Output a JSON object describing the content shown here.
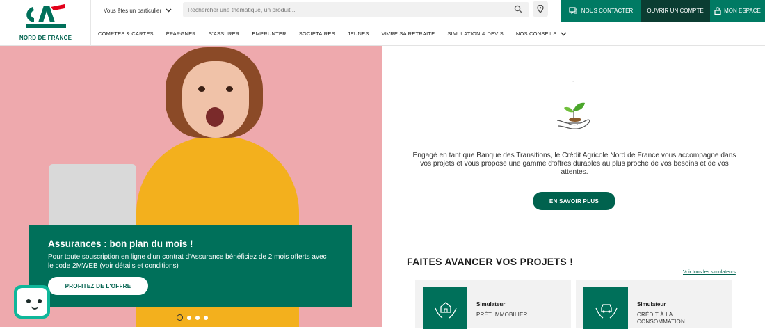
{
  "brand": {
    "logo_text": "NORD DE FRANCE",
    "primary_color": "#00705a",
    "dark_color": "#0b3d32",
    "accent_red": "#e2001a"
  },
  "header": {
    "profile_label": "Vous êtes un particulier",
    "search_placeholder": "Rechercher une thématique, un produit...",
    "contact_label": "NOUS CONTACTER",
    "open_account_label": "OUVRIR UN COMPTE",
    "my_space_label": "MON ESPACE"
  },
  "nav": {
    "items": [
      "COMPTES & CARTES",
      "ÉPARGNER",
      "S'ASSURER",
      "EMPRUNTER",
      "SOCIÉTAIRES",
      "JEUNES",
      "VIVRE SA RETRAITE",
      "SIMULATION & DEVIS",
      "NOS CONSEILS"
    ]
  },
  "hero": {
    "promo_title": "Assurances : bon plan du mois !",
    "promo_text": "Pour toute souscription en ligne d'un contrat d'Assurance bénéficiez de 2 mois offerts avec le code 2MWEB (voir détails et conditions)",
    "promo_cta": "PROFITEZ DE L'OFFRE",
    "slides_total": 4,
    "active_slide": 1
  },
  "commitment": {
    "dash": "-",
    "text": "Engagé en tant que Banque des Transitions, le Crédit Agricole Nord de France vous accompagne dans vos projets et vous propose une gamme d'offres durables au plus proche de vos besoins et de vos attentes.",
    "cta": "EN SAVOIR PLUS"
  },
  "projects": {
    "title": "FAITES AVANCER VOS PROJETS !",
    "see_all": "Voir tous les simulateurs",
    "cards": [
      {
        "kind": "Simulateur",
        "name": "PRÊT IMMOBILIER",
        "icon": "house-hands-icon"
      },
      {
        "kind": "Simulateur",
        "name": "CRÉDIT À LA CONSOMMATION",
        "icon": "car-hands-icon"
      }
    ]
  }
}
